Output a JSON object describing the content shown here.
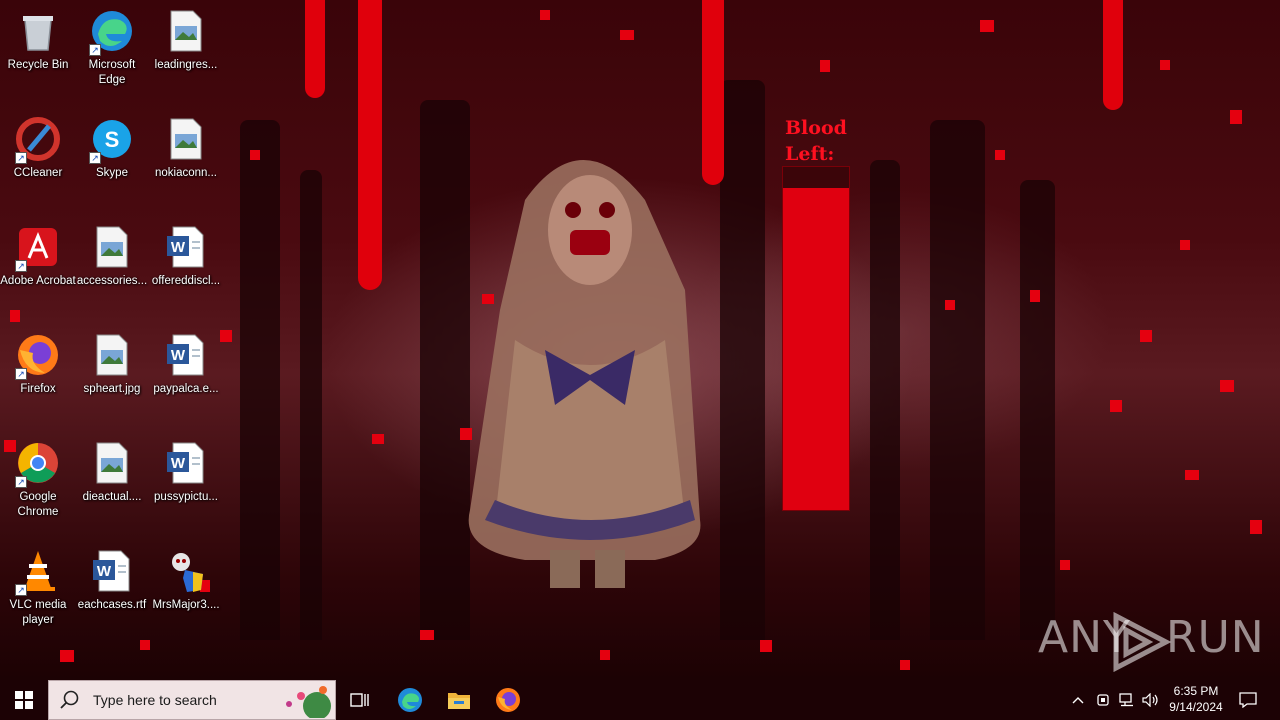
{
  "desktop": {
    "icons": [
      {
        "label": "Recycle Bin",
        "icon": "recycle-bin-icon"
      },
      {
        "label": "Microsoft Edge",
        "icon": "edge-icon"
      },
      {
        "label": "leadingres...",
        "icon": "image-file-icon"
      },
      {
        "label": "CCleaner",
        "icon": "ccleaner-icon"
      },
      {
        "label": "Skype",
        "icon": "skype-icon"
      },
      {
        "label": "nokiaconn...",
        "icon": "image-file-icon"
      },
      {
        "label": "Adobe Acrobat",
        "icon": "acrobat-icon"
      },
      {
        "label": "accessories...",
        "icon": "image-file-icon"
      },
      {
        "label": "offereddiscl...",
        "icon": "word-doc-icon"
      },
      {
        "label": "Firefox",
        "icon": "firefox-icon"
      },
      {
        "label": "spheart.jpg",
        "icon": "image-file-icon"
      },
      {
        "label": "paypalca.e...",
        "icon": "word-doc-icon"
      },
      {
        "label": "Google Chrome",
        "icon": "chrome-icon"
      },
      {
        "label": "dieactual....",
        "icon": "image-file-icon"
      },
      {
        "label": "pussypictu...",
        "icon": "word-doc-icon"
      },
      {
        "label": "VLC media player",
        "icon": "vlc-icon"
      },
      {
        "label": "eachcases.rtf",
        "icon": "word-doc-icon"
      },
      {
        "label": "MrsMajor3....",
        "icon": "mrsmajor-exe-icon"
      }
    ]
  },
  "overlay": {
    "blood_meter": {
      "title": "Blood Left:",
      "level": 0.94,
      "color": "#e00010"
    }
  },
  "watermark": {
    "text_left": "ANY",
    "text_right": "RUN"
  },
  "taskbar": {
    "search_placeholder": "Type here to search",
    "pinned": [
      {
        "name": "task-view-icon"
      },
      {
        "name": "edge-icon"
      },
      {
        "name": "file-explorer-icon"
      },
      {
        "name": "firefox-icon"
      }
    ],
    "clock": {
      "time": "6:35 PM",
      "date": "9/14/2024"
    }
  },
  "colors": {
    "blood": "#e5000f",
    "taskbar": "#1c0205",
    "search_bg": "#f1e4e5"
  }
}
